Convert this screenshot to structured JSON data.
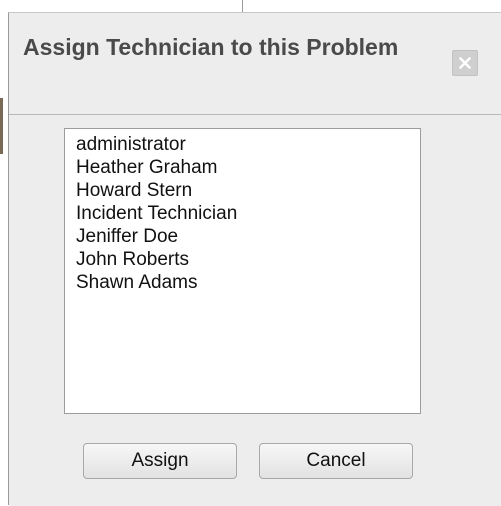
{
  "dialog": {
    "title": "Assign Technician to this Problem",
    "close_icon": "close-x-icon"
  },
  "technicians": {
    "items": [
      "administrator",
      "Heather Graham",
      "Howard Stern",
      "Incident Technician",
      "Jeniffer Doe",
      "John Roberts",
      "Shawn Adams"
    ]
  },
  "buttons": {
    "assign_label": "Assign",
    "cancel_label": "Cancel"
  },
  "colors": {
    "dialog_background": "#ededed",
    "title_text": "#4a4a4a",
    "close_button": "#cfcfcf"
  }
}
